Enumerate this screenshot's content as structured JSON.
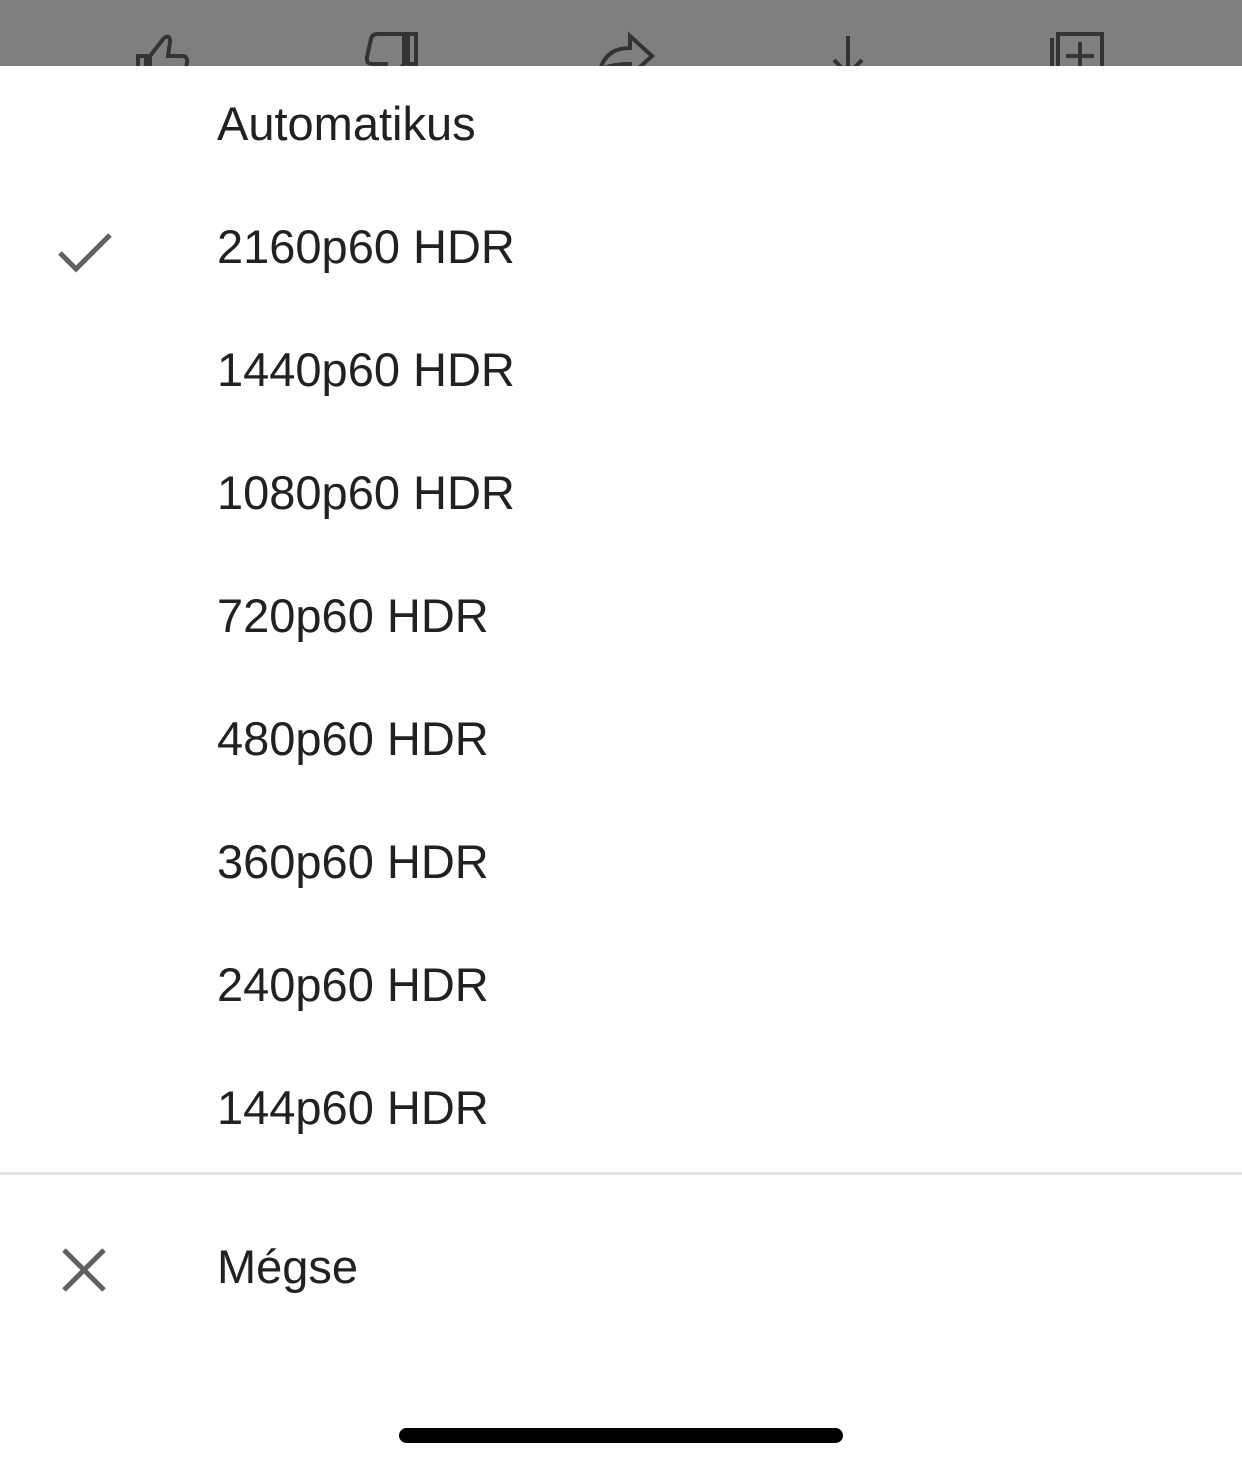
{
  "background_bar": {
    "icons": [
      "like-icon",
      "dislike-icon",
      "share-icon",
      "download-icon",
      "save-to-playlist-icon"
    ]
  },
  "quality_menu": {
    "selected_index": 1,
    "options": [
      {
        "label": "Automatikus"
      },
      {
        "label": "2160p60 HDR"
      },
      {
        "label": "1440p60 HDR"
      },
      {
        "label": "1080p60 HDR"
      },
      {
        "label": "720p60 HDR"
      },
      {
        "label": "480p60 HDR"
      },
      {
        "label": "360p60 HDR"
      },
      {
        "label": "240p60 HDR"
      },
      {
        "label": "144p60 HDR"
      }
    ]
  },
  "cancel": {
    "label": "Mégse"
  },
  "colors": {
    "text": "#212121",
    "icon": "#606060",
    "dim": "#7f7f7f",
    "divider": "#e3e3e3"
  }
}
